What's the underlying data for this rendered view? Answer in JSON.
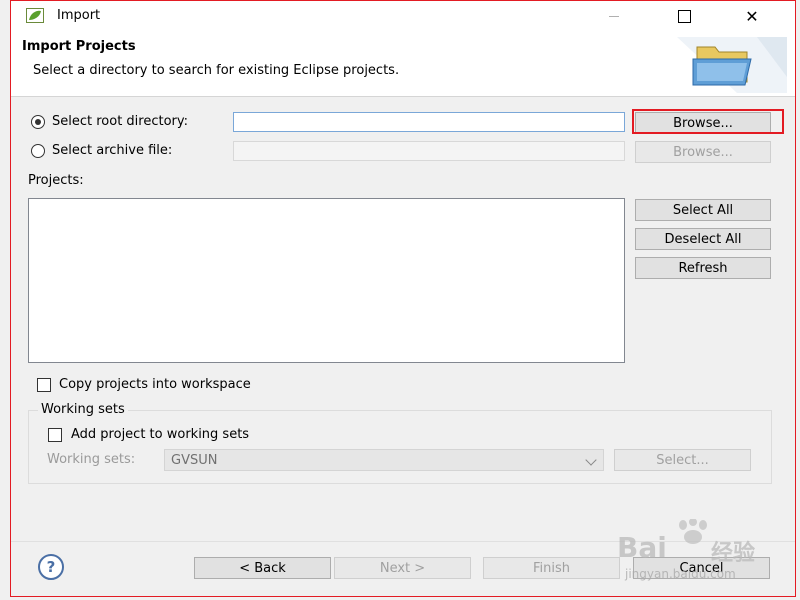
{
  "window": {
    "title": "Import"
  },
  "banner": {
    "title": "Import Projects",
    "description": "Select a directory to search for existing Eclipse projects."
  },
  "source": {
    "root_radio_label": "Select root directory:",
    "root_value": "",
    "archive_radio_label": "Select archive file:",
    "archive_value": "",
    "browse_label": "Browse...",
    "browse_archive_label": "Browse..."
  },
  "projects": {
    "label": "Projects:",
    "select_all_label": "Select All",
    "deselect_all_label": "Deselect All",
    "refresh_label": "Refresh"
  },
  "options": {
    "copy_label": "Copy projects into workspace"
  },
  "working_sets": {
    "group_label": "Working sets",
    "add_label": "Add project to working sets",
    "combo_label": "Working sets:",
    "combo_value": "GVSUN",
    "select_label": "Select..."
  },
  "footer": {
    "help_symbol": "?",
    "back_label": "< Back",
    "next_label": "Next >",
    "finish_label": "Finish",
    "cancel_label": "Cancel"
  },
  "watermark": {
    "brand": "Bai",
    "brand2": "经验",
    "url": "jingyan.baidu.com"
  },
  "colors": {
    "highlight": "#e31b23",
    "focus_border": "#7aa7d8"
  }
}
